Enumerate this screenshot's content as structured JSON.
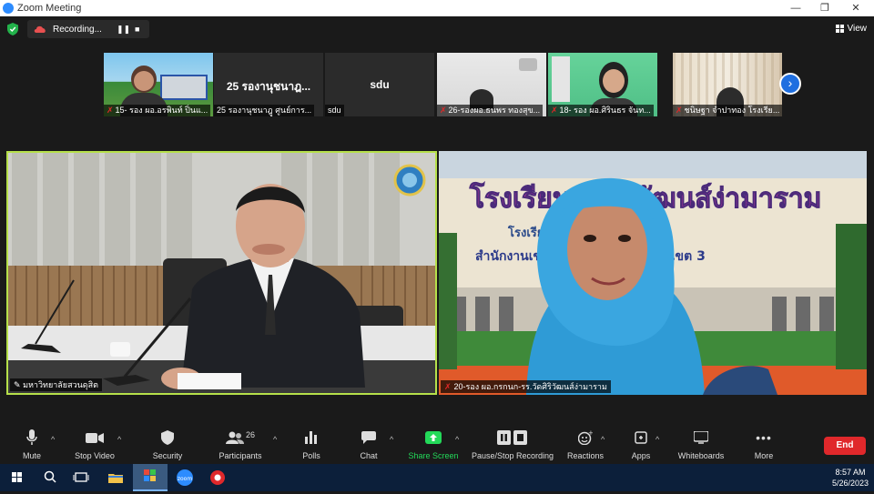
{
  "window": {
    "title": "Zoom Meeting",
    "minimize": "—",
    "restore": "❐",
    "close": "✕"
  },
  "topbar": {
    "recording_label": "Recording...",
    "pause_glyph": "❚❚",
    "stop_glyph": "■",
    "view_label": "View"
  },
  "thumbnails": [
    {
      "name": "15- รอง ผอ.อรพินท์ ปิ่นแ...",
      "muted": true
    },
    {
      "name": "25 รองานุชนาฎู ศูนย์การ...",
      "big_text": "25 รองานุชนาฎ...",
      "muted": false
    },
    {
      "name": "sdu",
      "big_text": "sdu",
      "muted": false
    },
    {
      "name": "26-รองผอ.ธนพร ทองสุข...",
      "muted": true
    },
    {
      "name": "18- รอง ผอ.ศิรินธร จันท...",
      "muted": true
    },
    {
      "name": "ชนิษฐา จำปาทอง โรงเรีย...",
      "muted": true
    }
  ],
  "main_left": {
    "name": "มหาวิทยาลัยสวนดุสิต"
  },
  "main_right": {
    "name": "20-รอง ผอ.กรกนก-รร.วัดศิริวัฒนส์ง่ามาราม",
    "sign_line1": "โรงเรียนวัดศิริวัฒนส์ง่ามาราม",
    "sign_line2": "โรงเรียนชายแดน",
    "sign_line3": "สำนักงานเขตพื้นที่การศึกษาสงขลา เขต 3"
  },
  "toolbar": {
    "mute": "Mute",
    "stop_video": "Stop Video",
    "security": "Security",
    "participants": "Participants",
    "participants_count": "26",
    "polls": "Polls",
    "chat": "Chat",
    "share_screen": "Share Screen",
    "pause_stop_recording": "Pause/Stop Recording",
    "reactions": "Reactions",
    "apps": "Apps",
    "whiteboards": "Whiteboards",
    "more": "More",
    "end": "End"
  },
  "taskbar": {
    "time": "8:57 AM",
    "date": "5/26/2023"
  },
  "colors": {
    "active_speaker_border": "#b6e04a",
    "end_button": "#e0282b",
    "share_green": "#23d959",
    "muted_red": "#e02828"
  }
}
